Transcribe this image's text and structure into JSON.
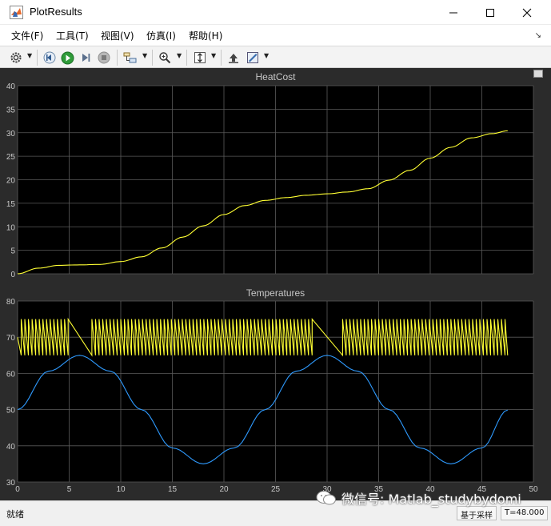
{
  "window": {
    "title": "PlotResults"
  },
  "menu": [
    "文件(F)",
    "工具(T)",
    "视图(V)",
    "仿真(I)",
    "帮助(H)"
  ],
  "toolbar": {
    "icons": [
      "gear-icon",
      "step-back-icon",
      "run-icon",
      "step-forward-icon",
      "stop-icon",
      "signal-select-icon",
      "zoom-icon",
      "fit-axes-icon",
      "highlight-icon",
      "style-icon"
    ]
  },
  "status": {
    "left": "就绪",
    "mode": "基于采样",
    "time": "T=48.000"
  },
  "watermark": "微信号: Matlab_studybydomi",
  "colors": {
    "plot_background": "#000000",
    "frame": "#2b2b2b",
    "grid": "#5a5a5a",
    "series_yellow": "#ffff33",
    "series_blue": "#2f9bff",
    "axis_text": "#c8c8c8"
  },
  "chart_data": [
    {
      "type": "line",
      "title": "HeatCost",
      "xlim": [
        0,
        50
      ],
      "ylim": [
        0,
        40
      ],
      "xticks": [
        0,
        5,
        10,
        15,
        20,
        25,
        30,
        35,
        40,
        45,
        50
      ],
      "yticks": [
        0,
        5,
        10,
        15,
        20,
        25,
        30,
        35,
        40
      ],
      "grid": true,
      "series": [
        {
          "color": "#ffff33",
          "x": [
            0,
            2,
            4,
            6,
            8,
            10,
            12,
            14,
            16,
            18,
            20,
            22,
            24,
            26,
            28,
            30,
            32,
            34,
            36,
            38,
            40,
            42,
            44,
            46,
            47.5
          ],
          "y": [
            0,
            1.2,
            1.8,
            1.9,
            2.0,
            2.6,
            3.6,
            5.5,
            7.8,
            10.2,
            12.6,
            14.5,
            15.6,
            16.2,
            16.7,
            17.0,
            17.4,
            18.1,
            19.9,
            22.0,
            24.6,
            26.9,
            28.9,
            29.8,
            30.4
          ]
        }
      ]
    },
    {
      "type": "line",
      "title": "Temperatures",
      "xlim": [
        0,
        50
      ],
      "ylim": [
        30,
        80
      ],
      "xticks": [
        0,
        5,
        10,
        15,
        20,
        25,
        30,
        35,
        40,
        45,
        50
      ],
      "yticks": [
        30,
        40,
        50,
        60,
        70,
        80
      ],
      "grid": true,
      "series": [
        {
          "color": "#2f9bff",
          "x": [
            0,
            3,
            6,
            9,
            12,
            15,
            18,
            21,
            24,
            27,
            30,
            33,
            36,
            39,
            42,
            45,
            47.5
          ],
          "y": [
            50,
            60.6,
            65,
            60.6,
            50,
            39.4,
            35,
            39.4,
            50,
            60.6,
            65,
            60.6,
            50,
            39.4,
            35,
            39.4,
            49.9
          ]
        },
        {
          "color": "#ffff33",
          "type": "sawtooth",
          "low": 65,
          "high": 75,
          "x_start": 0,
          "x_end": 47.5
        }
      ]
    }
  ]
}
